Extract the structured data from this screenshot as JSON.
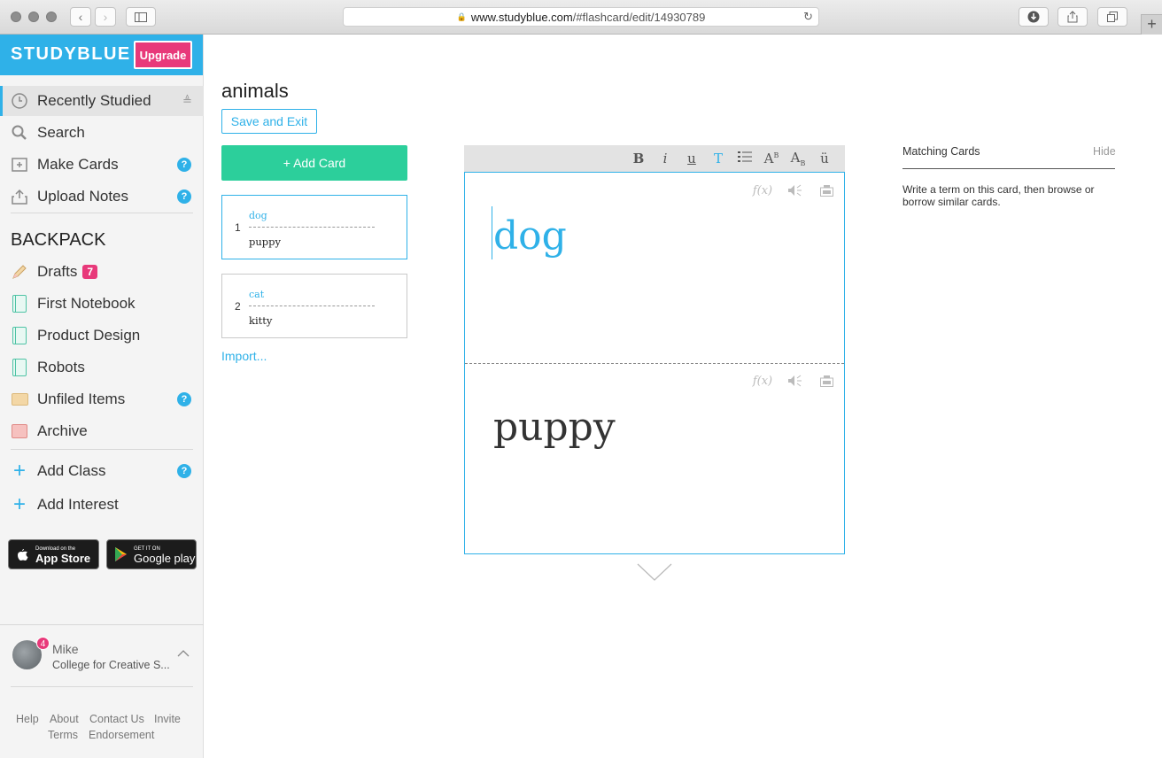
{
  "browser": {
    "url_host": "www.studyblue.com",
    "url_path": "/#flashcard/edit/14930789"
  },
  "brand": {
    "logo": "STUDYBLUE",
    "upgrade_label": "Upgrade"
  },
  "nav": {
    "recently_studied": "Recently Studied",
    "search": "Search",
    "make_cards": "Make Cards",
    "upload_notes": "Upload Notes"
  },
  "backpack": {
    "title": "BACKPACK",
    "drafts": "Drafts",
    "drafts_count": "7",
    "first_notebook": "First Notebook",
    "product_design": "Product Design",
    "robots": "Robots",
    "unfiled_items": "Unfiled Items",
    "archive": "Archive",
    "add_class": "Add Class",
    "add_interest": "Add Interest"
  },
  "stores": {
    "appstore_small": "Download on the",
    "appstore_big": "App Store",
    "googleplay_small": "GET IT ON",
    "googleplay_big": "Google play"
  },
  "user": {
    "name": "Mike",
    "school": "College for Creative S...",
    "notifications": "4"
  },
  "footer": {
    "help": "Help",
    "about": "About",
    "contact": "Contact Us",
    "invite": "Invite",
    "terms": "Terms",
    "endorsement": "Endorsement"
  },
  "deck": {
    "title": "animals",
    "save_exit": "Save and Exit",
    "add_card": "+ Add Card",
    "import": "Import...",
    "cards": [
      {
        "num": "1",
        "term": "dog",
        "definition": "puppy"
      },
      {
        "num": "2",
        "term": "cat",
        "definition": "kitty"
      }
    ]
  },
  "editor": {
    "toolbar": [
      "B",
      "i",
      "u",
      "T",
      "list",
      "AB",
      "AB",
      "ü"
    ],
    "formula_label": "f(x)",
    "front": "dog",
    "back": "puppy"
  },
  "matching": {
    "title": "Matching Cards",
    "hide": "Hide",
    "body": "Write a term on this card, then browse or borrow similar cards."
  },
  "colors": {
    "brand": "#2fb1e8",
    "accent": "#e8397a",
    "add_card": "#2ccf9b"
  }
}
